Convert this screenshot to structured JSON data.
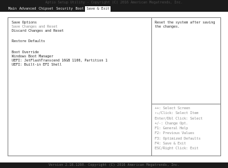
{
  "header": {
    "title": "Aptio Setup Utility - Copyright (C) 2016 American Megatrends, Inc.",
    "tabs": [
      {
        "label": "Main"
      },
      {
        "label": "Advanced"
      },
      {
        "label": "Chipset"
      },
      {
        "label": "Security"
      },
      {
        "label": "Boot"
      },
      {
        "label": "Save & Exit"
      }
    ]
  },
  "menu": {
    "save_options": "Save Options",
    "save_changes_reset": "Save Changes and Reset",
    "discard_changes_reset": "Discard Changes and Reset",
    "restore_defaults": "Restore Defaults",
    "boot_override": "Boot Override",
    "windows_boot_manager": "Windows Boot Manager",
    "uefi_jetflash": "UEFI: JetFlashTranscend 16GB 1100, Partition 1",
    "uefi_shell": "UEFI: Built-in EFI Shell"
  },
  "help": {
    "text": "Reset the system after saving the changes.",
    "keys": [
      "++: Select Screen",
      "↑↓/Click: Select Item",
      "Enter/Dbl Click: Select",
      "+/-: Change Opt.",
      "F1: General Help",
      "F2: Previous Values",
      "F3: Optimized Defaults",
      "F4: Save & Exit",
      "ESC/Right Click: Exit"
    ]
  },
  "footer": {
    "text": "Version 2.18.1260. Copyright (C) 2016 American Megatrends, Inc."
  }
}
